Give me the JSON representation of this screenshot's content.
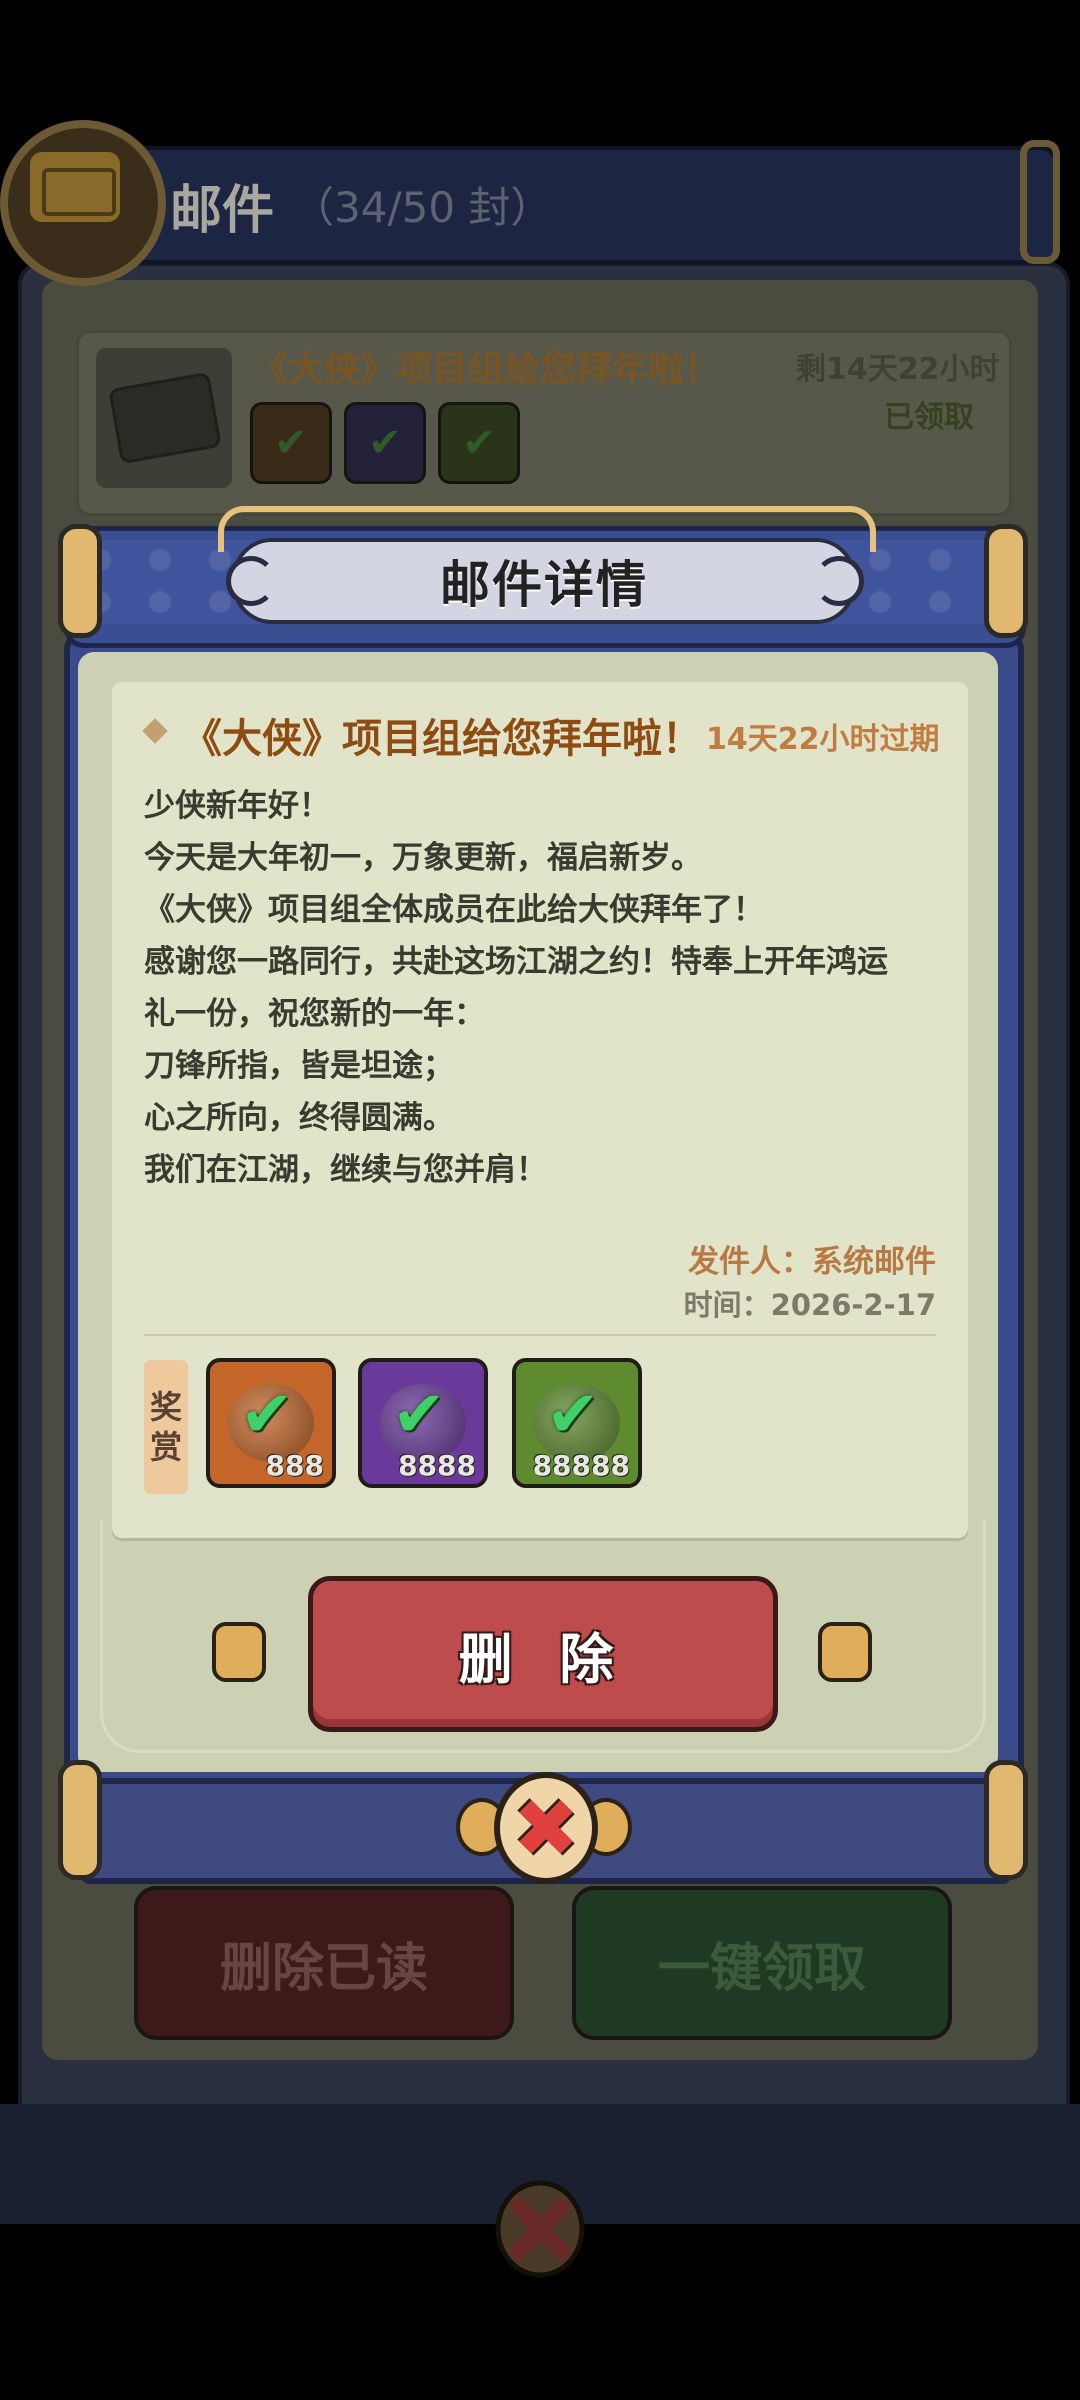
{
  "background": {
    "header": {
      "title": "邮件",
      "count": "（34/50 封）"
    },
    "list_item": {
      "title": "《大侠》项目组给您拜年啦！",
      "expire": "剩14天22小时",
      "status": "已领取"
    },
    "buttons": {
      "delete_read": "删除已读",
      "claim_all": "一键领取"
    }
  },
  "modal": {
    "title": "邮件详情",
    "mail": {
      "title": "《大侠》项目组给您拜年啦！",
      "expire": "14天22小时过期",
      "body_lines": [
        "少侠新年好！",
        "  今天是大年初一，万象更新，福启新岁。",
        "  《大侠》项目组全体成员在此给大侠拜年了！",
        "  感谢您一路同行，共赴这场江湖之约！特奉上开年鸿运",
        "礼一份，祝您新的一年：",
        "  刀锋所指，皆是坦途；",
        "  心之所向，终得圆满。",
        "  我们在江湖，继续与您并肩！"
      ],
      "sender": "发件人：系统邮件",
      "time": "时间：2026-2-17"
    },
    "reward_label": [
      "奖",
      "赏"
    ],
    "rewards": [
      {
        "count": "888",
        "color": "#c4662a",
        "status": "claimed"
      },
      {
        "count": "8888",
        "color": "#6a3a9a",
        "status": "claimed"
      },
      {
        "count": "88888",
        "color": "#5e8a30",
        "status": "claimed"
      }
    ],
    "delete_button": "删 除"
  },
  "colors": {
    "accent_title": "#8e4c13",
    "delete": "#be4c4c",
    "ribbon": "#3a4e94",
    "paper": "#e2e4ca"
  }
}
